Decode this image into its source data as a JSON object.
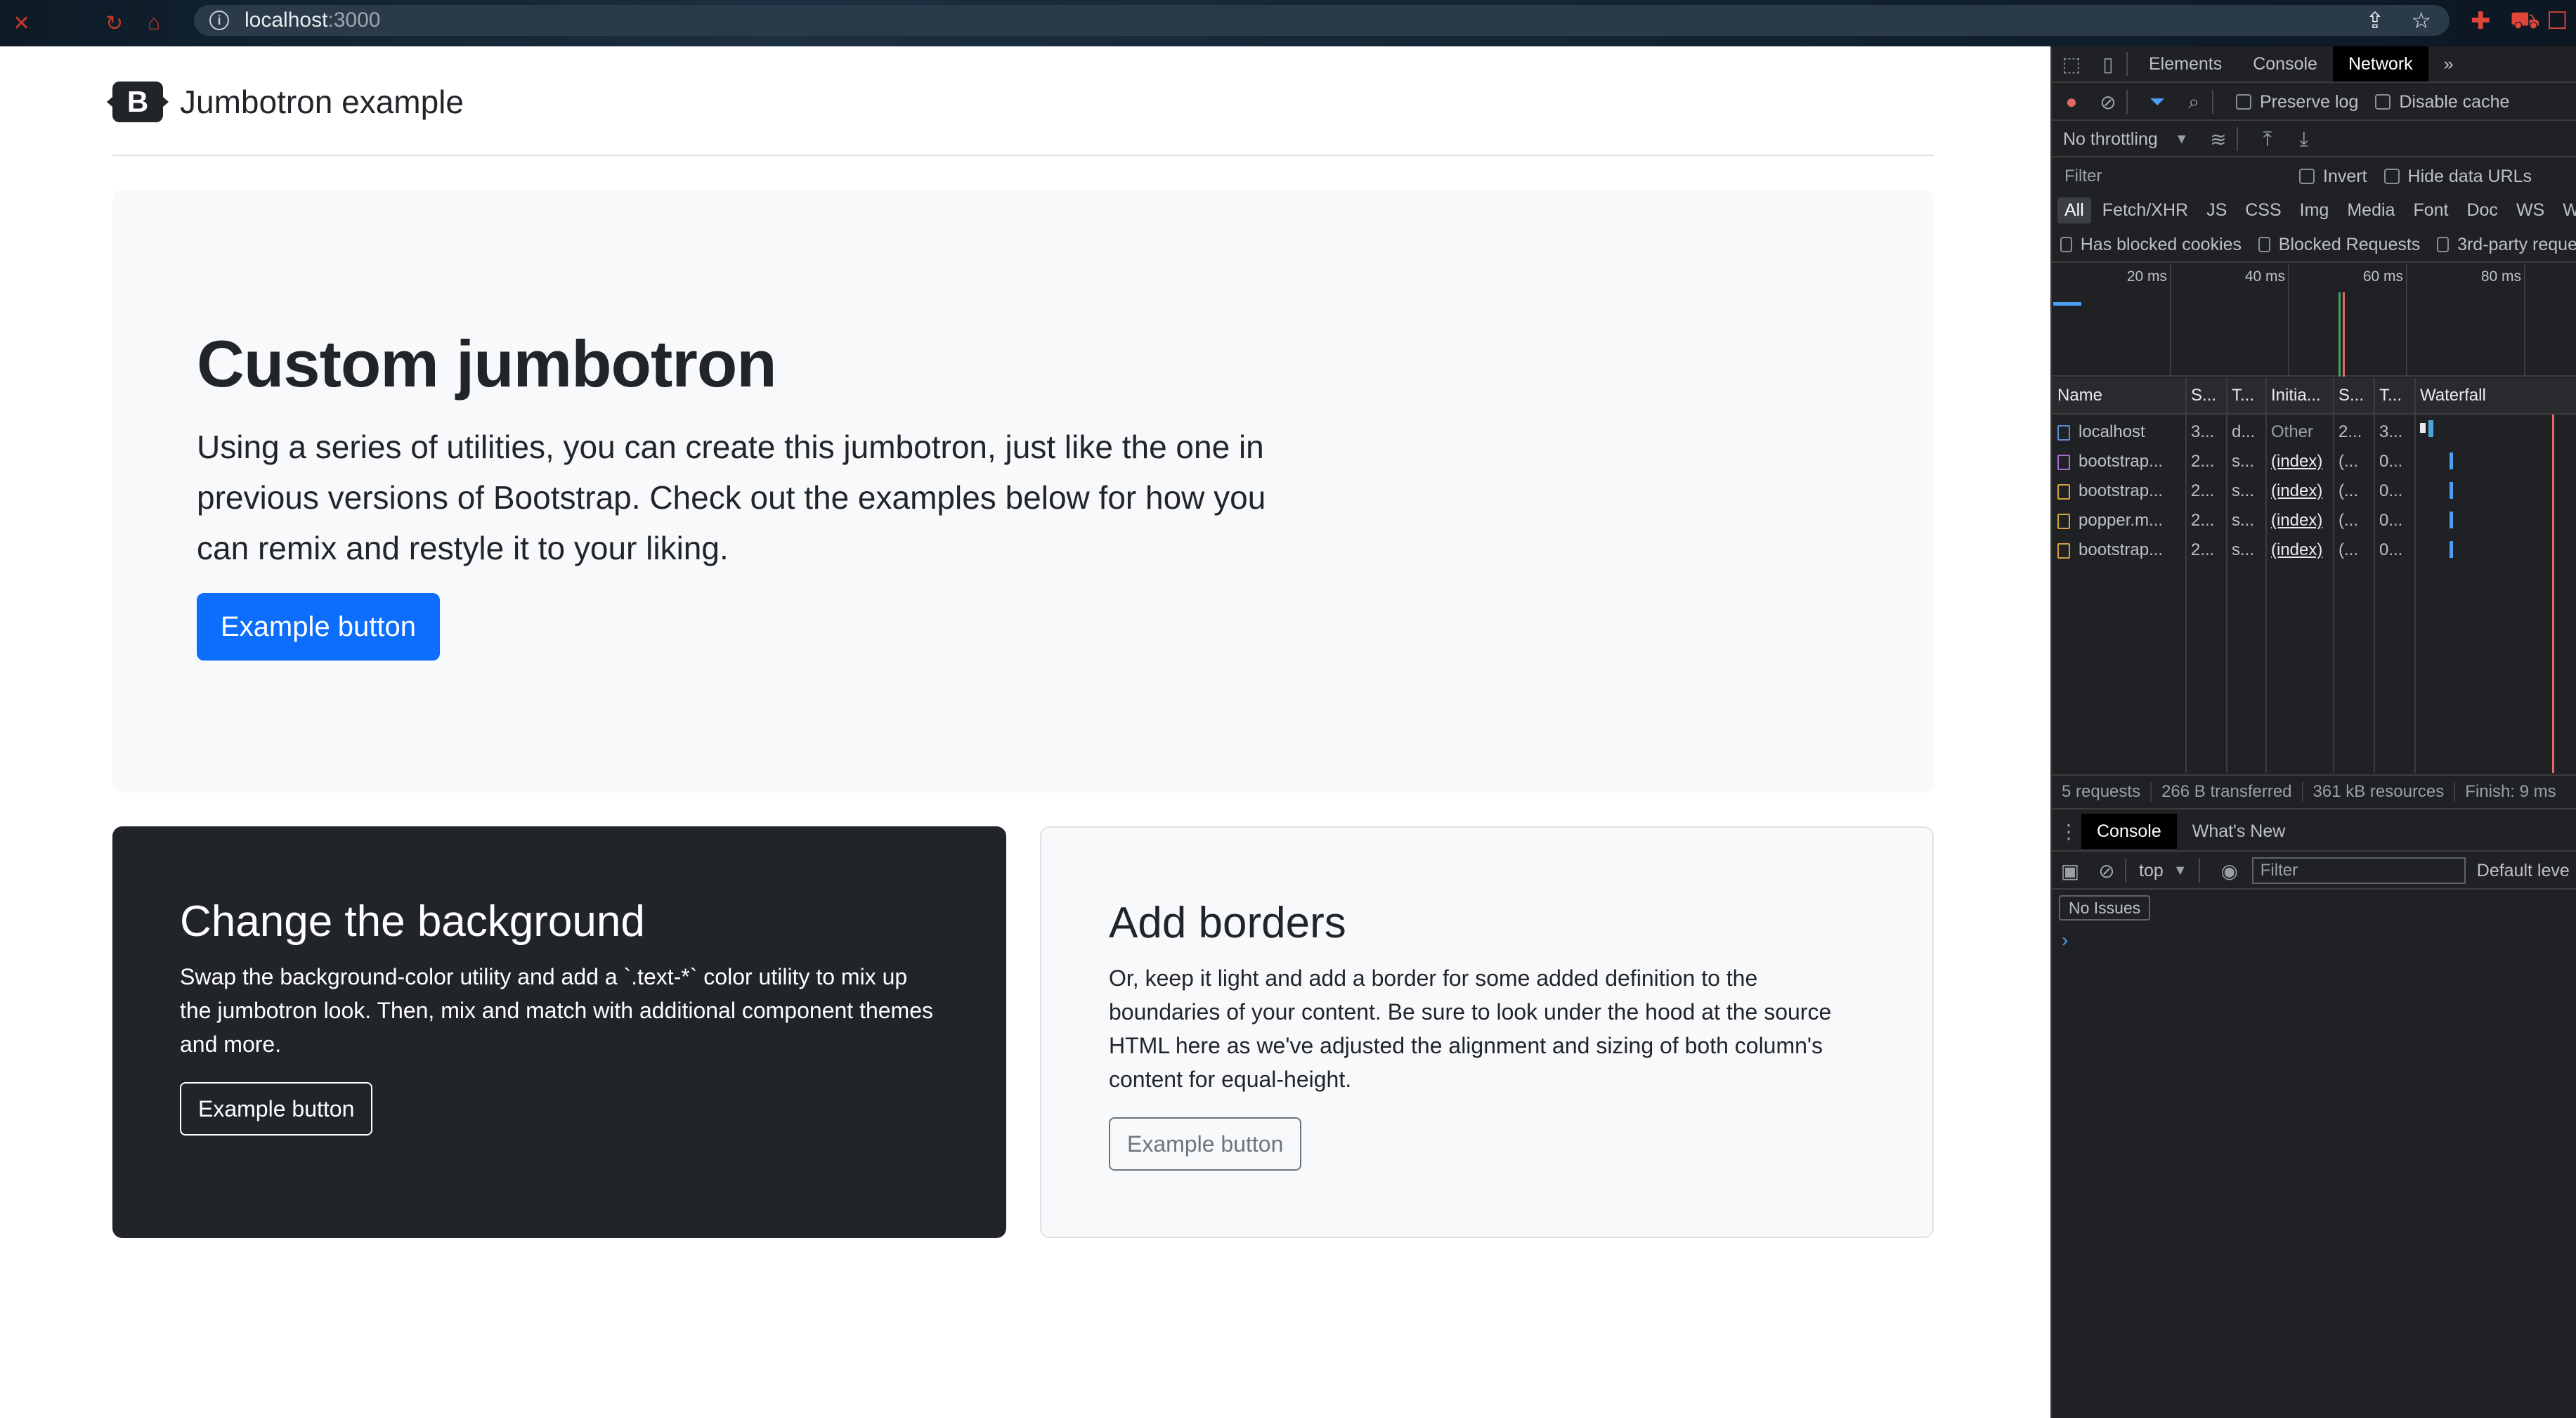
{
  "browser": {
    "url_host": "localhost",
    "url_port": ":3000"
  },
  "page": {
    "brand": "Jumbotron example",
    "logo_letter": "B",
    "jumbotron": {
      "title": "Custom jumbotron",
      "text": "Using a series of utilities, you can create this jumbotron, just like the one in previous versions of Bootstrap. Check out the examples below for how you can remix and restyle it to your liking.",
      "button": "Example button"
    },
    "card_dark": {
      "title": "Change the background",
      "text": "Swap the background-color utility and add a `.text-*` color utility to mix up the jumbotron look. Then, mix and match with additional component themes and more.",
      "button": "Example button"
    },
    "card_light": {
      "title": "Add borders",
      "text": "Or, keep it light and add a border for some added definition to the boundaries of your content. Be sure to look under the hood at the source HTML here as we've adjusted the alignment and sizing of both column's content for equal-height.",
      "button": "Example button"
    },
    "colors": {
      "primary": "#0d6efd",
      "dark": "#212529",
      "light": "#f8f9fa"
    }
  },
  "devtools": {
    "tabs": [
      "Elements",
      "Console",
      "Network"
    ],
    "active_tab": "Network",
    "more_tabs": "»",
    "toolbar": {
      "preserve_log": "Preserve log",
      "disable_cache": "Disable cache",
      "throttling": "No throttling"
    },
    "filter": {
      "placeholder": "Filter",
      "invert": "Invert",
      "hide_data_urls": "Hide data URLs",
      "types": [
        "All",
        "Fetch/XHR",
        "JS",
        "CSS",
        "Img",
        "Media",
        "Font",
        "Doc",
        "WS",
        "Wasm"
      ],
      "has_blocked_cookies": "Has blocked cookies",
      "blocked_requests": "Blocked Requests",
      "third_party": "3rd-party reque"
    },
    "timeline_ticks": [
      "20 ms",
      "40 ms",
      "60 ms",
      "80 ms"
    ],
    "table": {
      "headers": [
        "Name",
        "S...",
        "T...",
        "Initia...",
        "S...",
        "T...",
        "Waterfall"
      ],
      "rows": [
        {
          "name": "localhost",
          "status": "3...",
          "type": "d...",
          "initiator": "Other",
          "size": "2...",
          "time": "3..."
        },
        {
          "name": "bootstrap...",
          "status": "2...",
          "type": "s...",
          "initiator": "(index)",
          "size": "(...",
          "time": "0..."
        },
        {
          "name": "bootstrap...",
          "status": "2...",
          "type": "s...",
          "initiator": "(index)",
          "size": "(...",
          "time": "0..."
        },
        {
          "name": "popper.m...",
          "status": "2...",
          "type": "s...",
          "initiator": "(index)",
          "size": "(...",
          "time": "0..."
        },
        {
          "name": "bootstrap...",
          "status": "2...",
          "type": "s...",
          "initiator": "(index)",
          "size": "(...",
          "time": "0..."
        }
      ]
    },
    "status_bar": {
      "requests": "5 requests",
      "transferred": "266 B transferred",
      "resources": "361 kB resources",
      "finish": "Finish: 9 ms"
    },
    "drawer": {
      "tabs": [
        "Console",
        "What's New"
      ],
      "context": "top",
      "filter_placeholder": "Filter",
      "levels": "Default leve",
      "issues": "No Issues",
      "prompt": "›"
    }
  }
}
